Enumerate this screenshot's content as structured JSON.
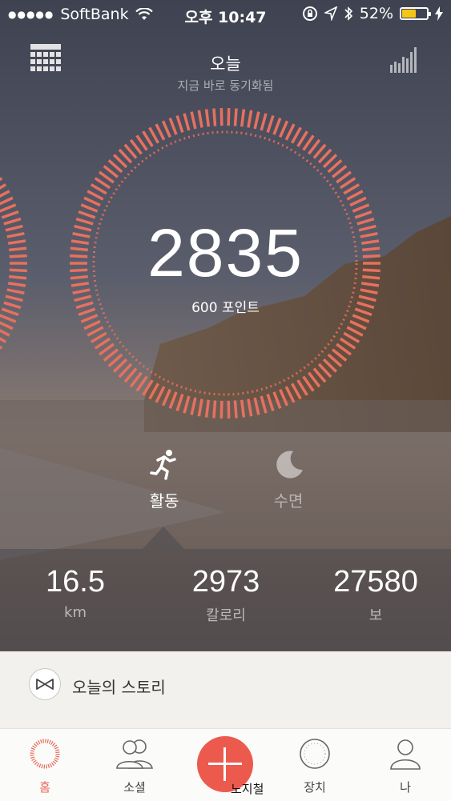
{
  "status_bar": {
    "carrier": "SoftBank",
    "signal_dots": "●●●●●",
    "time": "오후 10:47",
    "battery": "52%",
    "battery_level": 0.52,
    "icons": [
      "wifi-icon",
      "rotation-lock-icon",
      "location-icon",
      "bluetooth-icon",
      "battery-icon",
      "charging-icon"
    ]
  },
  "header": {
    "title": "오늘",
    "subtitle": "지금 바로 동기화됨",
    "left_icon": "calendar-grid-icon",
    "right_icon": "bar-chart-icon"
  },
  "progress": {
    "steps_points": "2835",
    "goal_label": "600 포인트"
  },
  "modes": {
    "activity": "활동",
    "sleep": "수면",
    "selected": "activity"
  },
  "metrics": [
    {
      "value": "16.5",
      "label": "km"
    },
    {
      "value": "2973",
      "label": "칼로리"
    },
    {
      "value": "27580",
      "label": "보"
    }
  ],
  "story": {
    "label": "오늘의 스토리",
    "icon": "bowtie-logo-icon"
  },
  "tabs": [
    {
      "label": "홈",
      "icon": "ring-icon",
      "active": true
    },
    {
      "label": "소셜",
      "icon": "people-icon",
      "active": false
    },
    {
      "label": "노지철",
      "icon": "plus-icon",
      "active": false
    },
    {
      "label": "장치",
      "icon": "device-watch-icon",
      "active": false
    },
    {
      "label": "나",
      "icon": "person-icon",
      "active": false
    }
  ],
  "colors": {
    "accent": "#ec5a4e",
    "ring": "#e8705e"
  }
}
